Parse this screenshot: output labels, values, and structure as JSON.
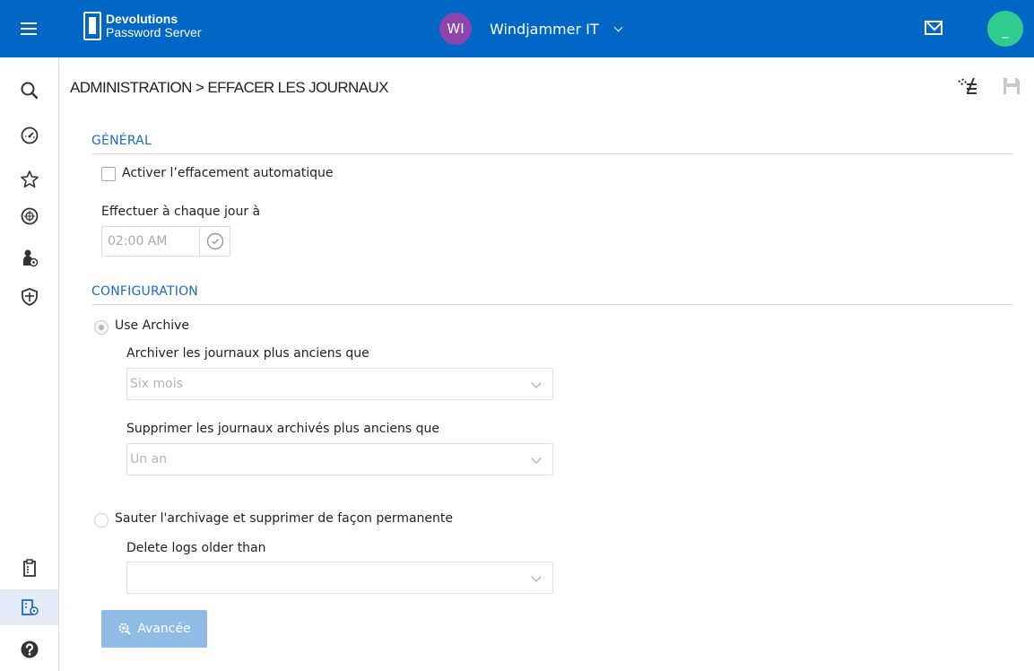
{
  "app": {
    "logo_line1": "Devolutions",
    "logo_line2": "Password Server"
  },
  "topbar": {
    "vault_initials": "WI",
    "vault_name": "Windjammer IT",
    "user_initial": "_"
  },
  "sidebar": {
    "items": [
      {
        "icon": "search-icon"
      },
      {
        "icon": "dashboard-icon"
      },
      {
        "icon": "star-icon"
      },
      {
        "icon": "vault-icon"
      },
      {
        "icon": "user-settings-icon"
      },
      {
        "icon": "shield-icon"
      },
      {
        "icon": "reports-icon"
      },
      {
        "icon": "administration-icon"
      },
      {
        "icon": "help-icon"
      }
    ]
  },
  "header": {
    "breadcrumb": "ADMINISTRATION  >  EFFACER LES JOURNAUX"
  },
  "general": {
    "section_title": "GÉNÉRAL",
    "auto_delete_label": "Activer l’effacement automatique",
    "auto_delete_checked": false,
    "schedule_label": "Effectuer à chaque jour à",
    "time_value": "02:00 AM"
  },
  "configuration": {
    "section_title": "CONFIGURATION",
    "use_archive_label": "Use Archive",
    "use_archive_selected": true,
    "archive_older_label": "Archiver les journaux plus anciens que",
    "archive_older_value": "Six mois",
    "delete_archived_label": "Supprimer les journaux archivés plus anciens que",
    "delete_archived_value": "Un an",
    "skip_archive_label": "Sauter l'archivage et supprimer de façon permanente",
    "skip_archive_selected": false,
    "delete_older_label": "Delete logs older than",
    "delete_older_value": ""
  },
  "actions": {
    "advanced_label": "Avancée"
  },
  "colors": {
    "topbar": "#0067c6",
    "accent": "#1a6bc6",
    "vault_avatar": "#8e44ad",
    "user_avatar": "#2ecc8f",
    "advanced_button": "#8fbce7"
  }
}
